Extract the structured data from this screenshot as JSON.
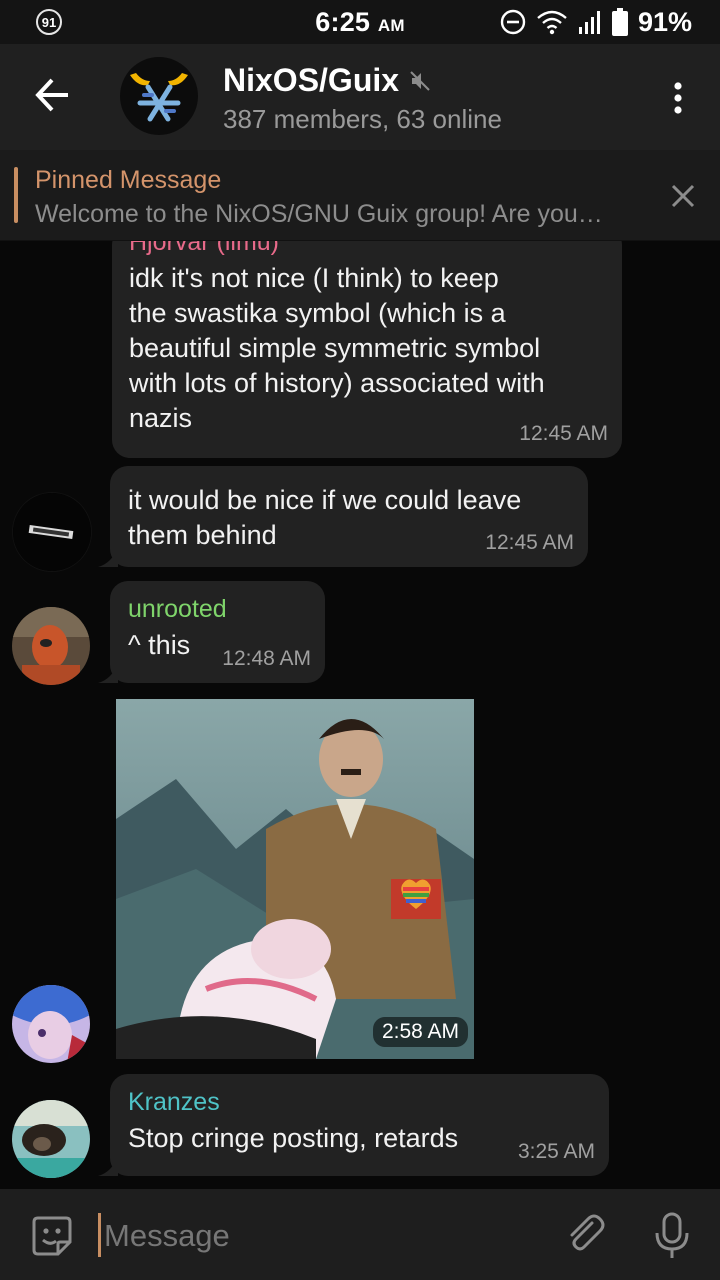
{
  "status_bar": {
    "notification_count": "91",
    "time": "6:25",
    "time_suffix": "AM",
    "battery_percent": "91%"
  },
  "header": {
    "title": "NixOS/Guix",
    "subtitle": "387 members, 63 online",
    "muted_icon": "muted-speaker-icon"
  },
  "pinned": {
    "label": "Pinned Message",
    "text": "Welcome to the NixOS/GNU Guix group!  Are you…"
  },
  "messages": [
    {
      "sender": "Hjorvar (ilmu)",
      "text_lines": [
        "idk it's not nice (I think) to keep",
        "the swastika symbol (which is a",
        "beautiful simple symmetric symbol",
        "with lots of history) associated with",
        "nazis"
      ],
      "time": "12:45 AM",
      "name_color": "#e86a8a"
    },
    {
      "text_lines": [
        "it would be nice if we could leave",
        "them behind"
      ],
      "time": "12:45 AM"
    },
    {
      "sender": "unrooted",
      "text": "^ this",
      "time": "12:48 AM",
      "name_color": "#7fd46b"
    },
    {
      "type": "photo",
      "time": "2:58 AM"
    },
    {
      "sender": "Kranzes",
      "text": "Stop cringe posting, retards",
      "time": "3:25 AM",
      "name_color": "#4fc3c7"
    }
  ],
  "input": {
    "placeholder": "Message"
  },
  "colors": {
    "accent": "#c88e62",
    "bubble": "#222222",
    "header": "#202020"
  }
}
